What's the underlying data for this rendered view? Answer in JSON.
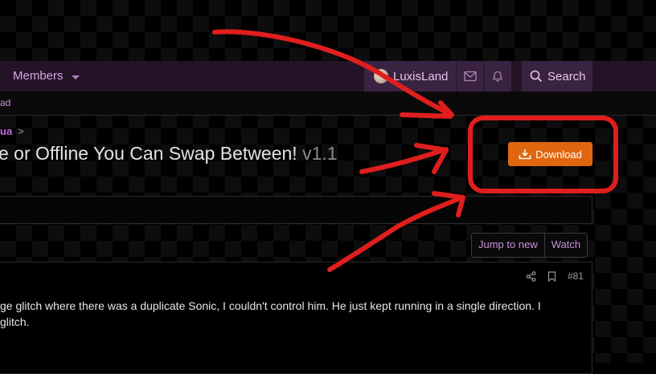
{
  "nav": {
    "members_label": "Members",
    "username": "LuxisLand",
    "search_label": "Search"
  },
  "subnav": {
    "text": "ad"
  },
  "breadcrumb": {
    "text": "ua",
    "separator": ">"
  },
  "resource": {
    "title": "e or Offline You Can Swap Between!",
    "version": "v1.1",
    "download_label": "Download"
  },
  "thread_actions": {
    "jump_label": "Jump to new",
    "watch_label": "Watch"
  },
  "post": {
    "number": "#81",
    "text_line1": "ge glitch where there was a duplicate Sonic, I couldn't control him. He just kept running in a single direction. I",
    "text_line2": "glitch."
  },
  "colors": {
    "accent": "#e0660f",
    "annotation": "#e01e1e",
    "link": "#c764e6"
  }
}
